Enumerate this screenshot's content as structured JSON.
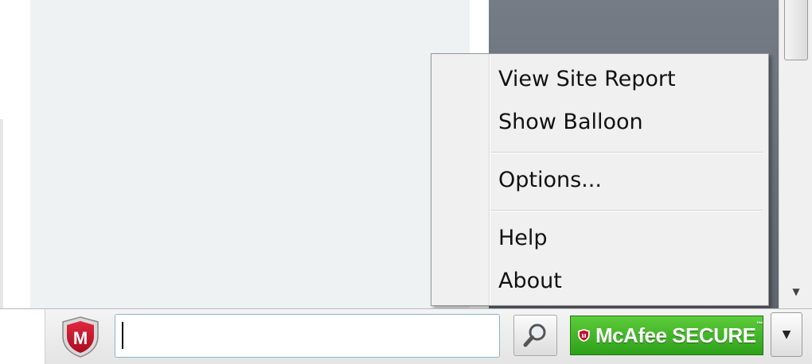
{
  "context_menu": {
    "items": [
      {
        "label": "View Site Report"
      },
      {
        "label": "Show Balloon"
      },
      {
        "label": "Options..."
      },
      {
        "label": "Help"
      },
      {
        "label": "About"
      }
    ]
  },
  "toolbar": {
    "search_value": "",
    "brand_text": "McAfee SECURE",
    "trademark": "™",
    "logo_letter": "M",
    "search_icon": "magnifier-icon",
    "dropdown_icon": "chevron-down-icon"
  },
  "colors": {
    "brand_red": "#c8102e",
    "secure_green": "#3bb026",
    "menu_bg": "#f0f0f0"
  }
}
